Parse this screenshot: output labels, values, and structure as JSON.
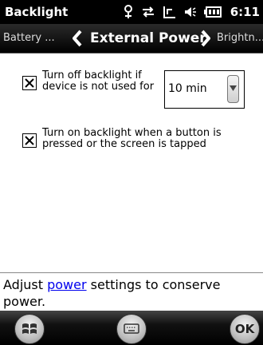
{
  "title_bar": {
    "title": "Backlight",
    "time": "6:11",
    "icons": [
      "network-icon",
      "sync-icon",
      "signal-icon",
      "volume-icon",
      "battery-icon"
    ]
  },
  "nav": {
    "prev_label": "Battery ...",
    "current_label": "External Power",
    "next_label": "Brightn..."
  },
  "options": [
    {
      "label_line1": "Turn off backlight if",
      "label_line2": "device is not used for",
      "checked": true
    },
    {
      "label_line1": "Turn on backlight when a button is",
      "label_line2": "pressed or the screen is tapped",
      "checked": true
    }
  ],
  "timeout_select": {
    "value": "10 min"
  },
  "footer": {
    "text_before": "Adjust ",
    "link": "power",
    "text_after": " settings to conserve power."
  },
  "softkeys": {
    "ok_label": "OK"
  }
}
